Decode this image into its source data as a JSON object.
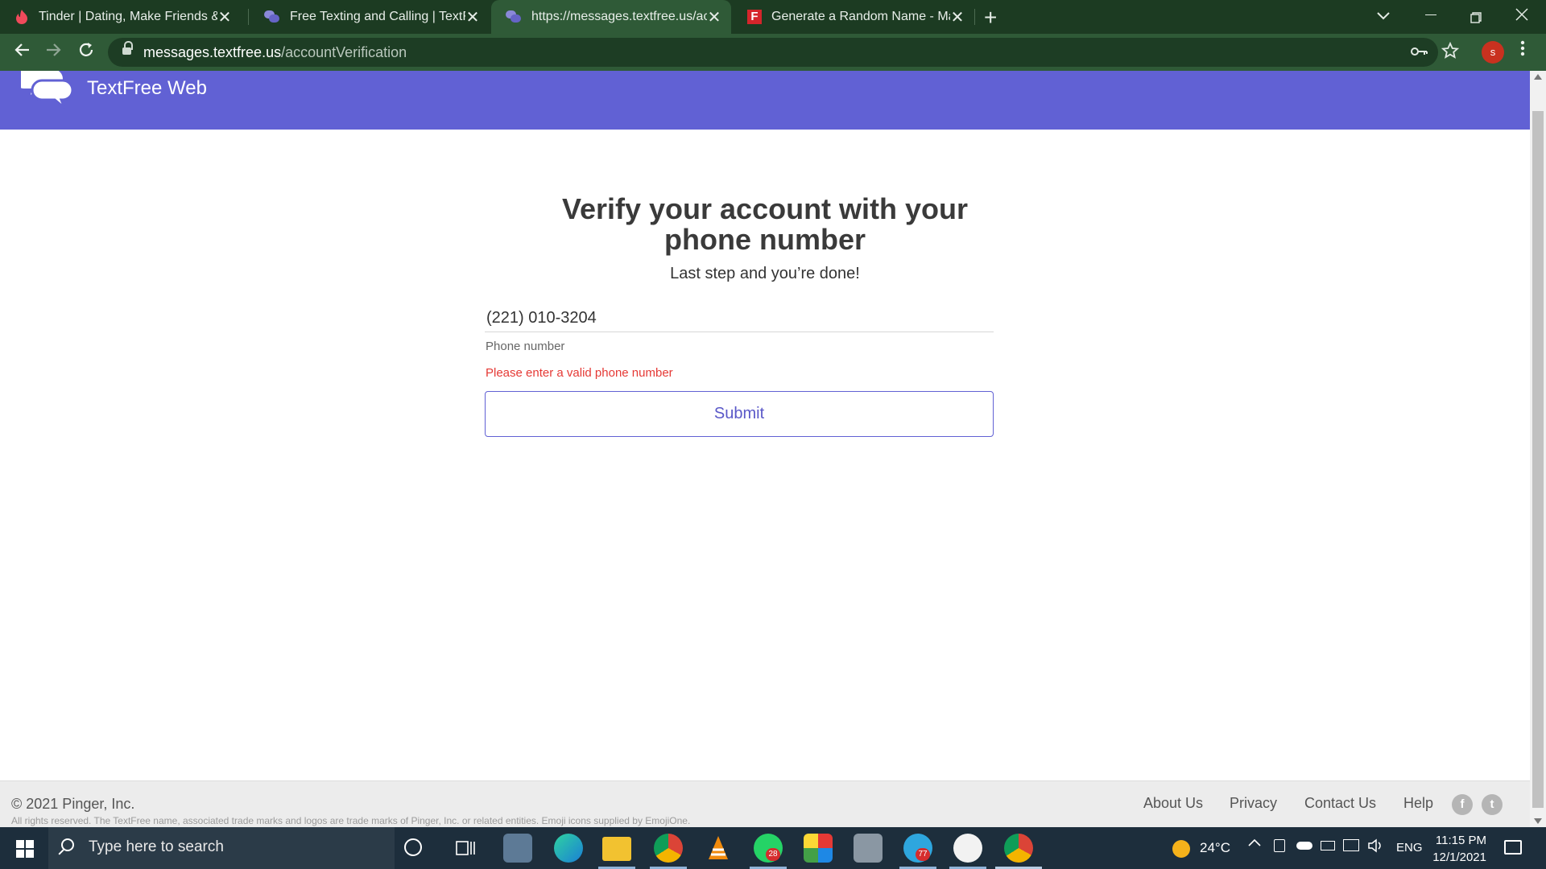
{
  "browser": {
    "tabs": [
      {
        "title": "Tinder | Dating, Make Friends & Meet New People",
        "close": "✕"
      },
      {
        "title": "Free Texting and Calling | TextFree",
        "close": "✕"
      },
      {
        "title": "https://messages.textfree.us/accountVerification",
        "close": "✕"
      },
      {
        "title": "Generate a Random Name - Male",
        "close": "✕"
      }
    ],
    "new_tab": "+",
    "url_domain": "messages.textfree.us",
    "url_path": "/accountVerification",
    "profile_initial": "s"
  },
  "site": {
    "brand": "TextFree Web",
    "header_color": "#6161d4"
  },
  "verify": {
    "title": "Verify your account with your phone number",
    "subtitle": "Last step and you’re done!",
    "phone_value": "(221) 010-3204",
    "phone_label": "Phone number",
    "error": "Please enter a valid phone number",
    "submit_label": "Submit"
  },
  "footer": {
    "copyright": "© 2021 Pinger, Inc.",
    "legal": "All rights reserved. The TextFree name, associated trade marks and logos are trade marks of Pinger, Inc. or related entities. Emoji icons supplied by EmojiOne.",
    "links": [
      "About Us",
      "Privacy",
      "Contact Us",
      "Help"
    ],
    "social": [
      "f",
      "t"
    ]
  },
  "taskbar": {
    "search_placeholder": "Type here to search",
    "badges": {
      "whatsapp": "28",
      "telegram": "77"
    },
    "weather": "24°C",
    "language": "ENG",
    "time": "11:15 PM",
    "date": "12/1/2021"
  }
}
